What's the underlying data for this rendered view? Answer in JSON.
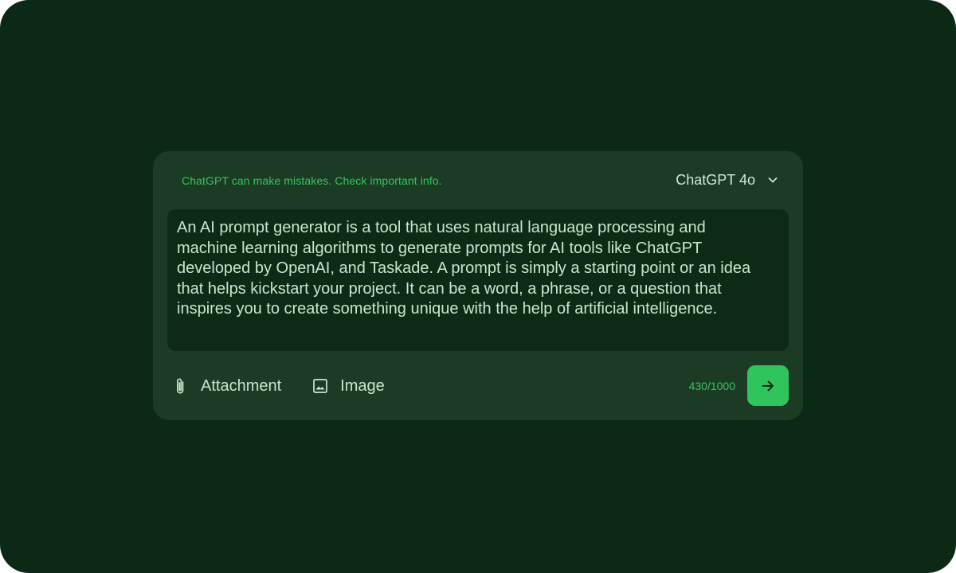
{
  "composer": {
    "disclaimer": "ChatGPT can make mistakes. Check important info.",
    "model": {
      "label": "ChatGPT 4o",
      "icon": "chevron-down-icon"
    },
    "prompt_text": "An AI prompt generator is a tool that uses natural language processing and machine learning algorithms to generate prompts for AI tools like ChatGPT developed by OpenAI, and Taskade. A prompt is simply a starting point or an idea that helps kickstart your project. It can be a word, a phrase, or a question that inspires you to create something unique with the help of artificial intelligence.",
    "actions": [
      {
        "label": "Attachment",
        "icon": "paperclip-icon"
      },
      {
        "label": "Image",
        "icon": "image-icon"
      }
    ],
    "char_count": "430/1000",
    "send": {
      "icon": "arrow-right-icon"
    }
  },
  "colors": {
    "background": "#0b2914",
    "card": "#1b3b24",
    "textarea": "#0d2a15",
    "accent": "#2fc55c",
    "accent_text": "#38c55d",
    "text": "#c6e7cd"
  }
}
